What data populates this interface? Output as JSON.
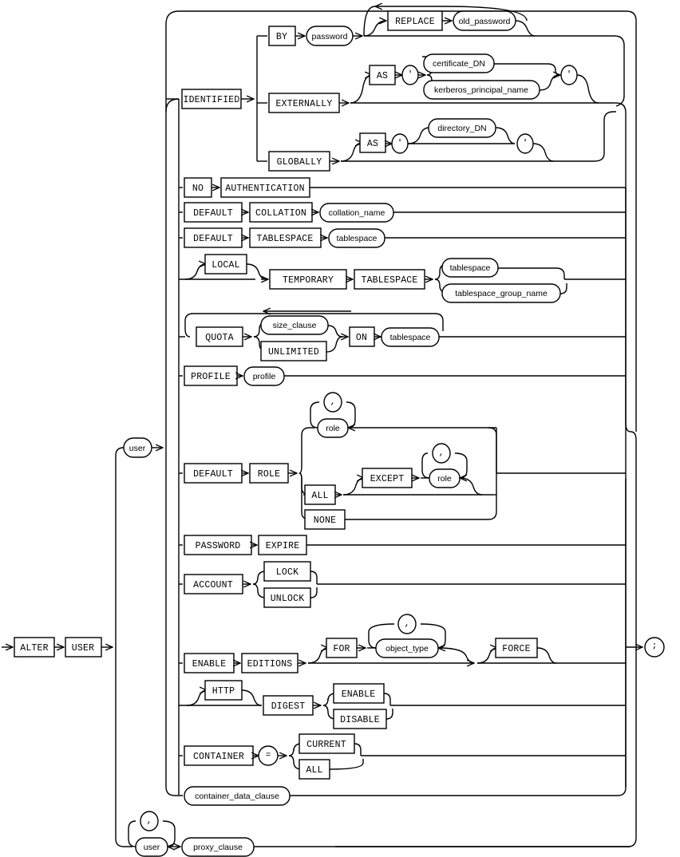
{
  "diagram": {
    "title": "alter_user",
    "type": "railroad-syntax-diagram",
    "colors": {
      "line": "#000000",
      "background": "#ffffff",
      "box_fill": "#ffffff"
    },
    "start_keywords": [
      {
        "id": "alter",
        "label": "ALTER",
        "kind": "keyword"
      },
      {
        "id": "user_kw",
        "label": "USER",
        "kind": "keyword"
      }
    ],
    "nonterminal_user": {
      "id": "user",
      "label": "user",
      "kind": "nonterminal"
    },
    "terminator": {
      "id": "semicolon",
      "label": ";",
      "kind": "punct"
    },
    "comma": {
      "label": ",",
      "kind": "punct"
    },
    "quote": {
      "label": "'",
      "kind": "punct"
    },
    "equals": {
      "label": "=",
      "kind": "punct"
    },
    "branches": [
      {
        "id": "identified",
        "label": "IDENTIFIED",
        "kind": "keyword",
        "options": [
          {
            "id": "by",
            "label": "BY",
            "kind": "keyword",
            "items": [
              {
                "label": "password",
                "kind": "nonterminal"
              },
              {
                "label": "REPLACE",
                "kind": "keyword"
              },
              {
                "label": "old_password",
                "kind": "nonterminal"
              }
            ]
          },
          {
            "id": "externally",
            "label": "EXTERNALLY",
            "kind": "keyword",
            "items": [
              {
                "label": "AS",
                "kind": "keyword"
              },
              {
                "label": "certificate_DN",
                "kind": "nonterminal"
              },
              {
                "label": "kerberos_principal_name",
                "kind": "nonterminal"
              }
            ]
          },
          {
            "id": "globally",
            "label": "GLOBALLY",
            "kind": "keyword",
            "items": [
              {
                "label": "AS",
                "kind": "keyword"
              },
              {
                "label": "directory_DN",
                "kind": "nonterminal"
              }
            ]
          }
        ]
      },
      {
        "id": "no_authentication",
        "items": [
          {
            "label": "NO",
            "kind": "keyword"
          },
          {
            "label": "AUTHENTICATION",
            "kind": "keyword"
          }
        ]
      },
      {
        "id": "default_collation",
        "items": [
          {
            "label": "DEFAULT",
            "kind": "keyword"
          },
          {
            "label": "COLLATION",
            "kind": "keyword"
          },
          {
            "label": "collation_name",
            "kind": "nonterminal"
          }
        ]
      },
      {
        "id": "default_tablespace",
        "items": [
          {
            "label": "DEFAULT",
            "kind": "keyword"
          },
          {
            "label": "TABLESPACE",
            "kind": "keyword"
          },
          {
            "label": "tablespace",
            "kind": "nonterminal"
          }
        ]
      },
      {
        "id": "local_temporary_tablespace",
        "items": [
          {
            "label": "LOCAL",
            "kind": "keyword"
          },
          {
            "label": "TEMPORARY",
            "kind": "keyword"
          },
          {
            "label": "TABLESPACE",
            "kind": "keyword"
          },
          {
            "label": "tablespace",
            "kind": "nonterminal"
          },
          {
            "label": "tablespace_group_name",
            "kind": "nonterminal"
          }
        ]
      },
      {
        "id": "quota",
        "items": [
          {
            "label": "QUOTA",
            "kind": "keyword"
          },
          {
            "label": "size_clause",
            "kind": "nonterminal"
          },
          {
            "label": "UNLIMITED",
            "kind": "keyword"
          },
          {
            "label": "ON",
            "kind": "keyword"
          },
          {
            "label": "tablespace",
            "kind": "nonterminal"
          }
        ]
      },
      {
        "id": "profile",
        "items": [
          {
            "label": "PROFILE",
            "kind": "keyword"
          },
          {
            "label": "profile",
            "kind": "nonterminal"
          }
        ]
      },
      {
        "id": "default_role",
        "items": [
          {
            "label": "DEFAULT",
            "kind": "keyword"
          },
          {
            "label": "ROLE",
            "kind": "keyword"
          },
          {
            "label": "role",
            "kind": "nonterminal"
          },
          {
            "label": "ALL",
            "kind": "keyword"
          },
          {
            "label": "EXCEPT",
            "kind": "keyword"
          },
          {
            "label": "role",
            "kind": "nonterminal"
          },
          {
            "label": "NONE",
            "kind": "keyword"
          }
        ]
      },
      {
        "id": "password_expire",
        "items": [
          {
            "label": "PASSWORD",
            "kind": "keyword"
          },
          {
            "label": "EXPIRE",
            "kind": "keyword"
          }
        ]
      },
      {
        "id": "account",
        "items": [
          {
            "label": "ACCOUNT",
            "kind": "keyword"
          },
          {
            "label": "LOCK",
            "kind": "keyword"
          },
          {
            "label": "UNLOCK",
            "kind": "keyword"
          }
        ]
      },
      {
        "id": "enable_editions",
        "items": [
          {
            "label": "ENABLE",
            "kind": "keyword"
          },
          {
            "label": "EDITIONS",
            "kind": "keyword"
          },
          {
            "label": "FOR",
            "kind": "keyword"
          },
          {
            "label": "object_type",
            "kind": "nonterminal"
          },
          {
            "label": "FORCE",
            "kind": "keyword"
          }
        ]
      },
      {
        "id": "http_digest",
        "items": [
          {
            "label": "HTTP",
            "kind": "keyword"
          },
          {
            "label": "DIGEST",
            "kind": "keyword"
          },
          {
            "label": "ENABLE",
            "kind": "keyword"
          },
          {
            "label": "DISABLE",
            "kind": "keyword"
          }
        ]
      },
      {
        "id": "container",
        "items": [
          {
            "label": "CONTAINER",
            "kind": "keyword"
          },
          {
            "label": "=",
            "kind": "punct"
          },
          {
            "label": "CURRENT",
            "kind": "keyword"
          },
          {
            "label": "ALL",
            "kind": "keyword"
          }
        ]
      },
      {
        "id": "container_data_clause",
        "items": [
          {
            "label": "container_data_clause",
            "kind": "nonterminal"
          }
        ]
      },
      {
        "id": "proxy",
        "items": [
          {
            "label": "user",
            "kind": "nonterminal"
          },
          {
            "label": "proxy_clause",
            "kind": "nonterminal"
          }
        ]
      }
    ]
  }
}
